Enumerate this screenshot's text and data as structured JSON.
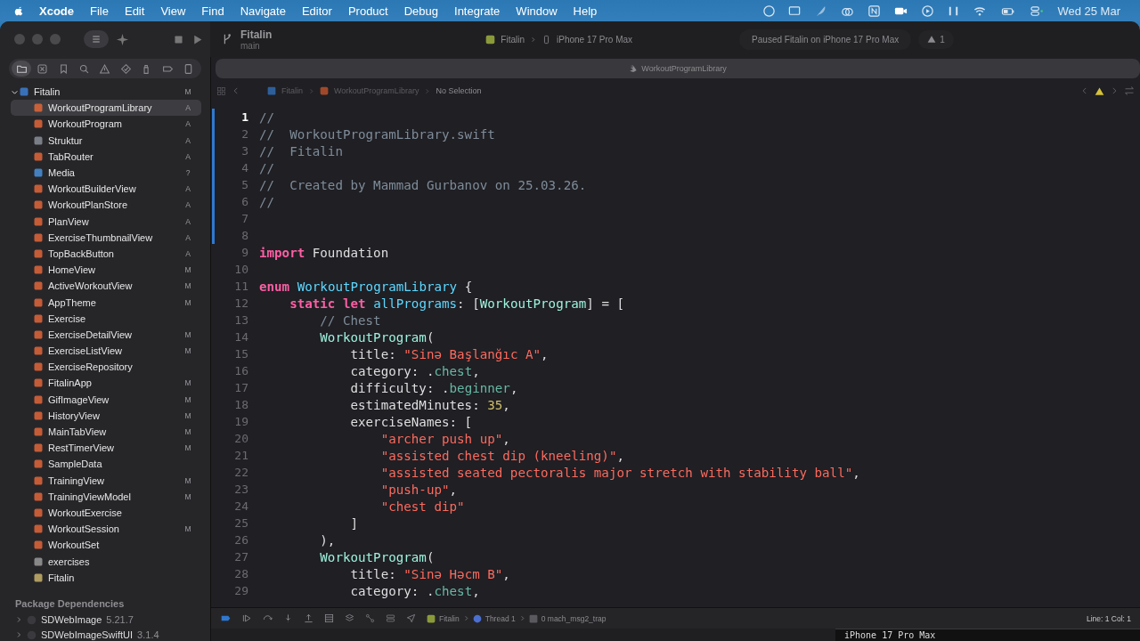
{
  "menu_bar": {
    "app": "Xcode",
    "items": [
      "File",
      "Edit",
      "View",
      "Find",
      "Navigate",
      "Editor",
      "Product",
      "Debug",
      "Integrate",
      "Window",
      "Help"
    ],
    "clock": "Wed 25 Mar"
  },
  "toolbar": {
    "project": "Fitalin",
    "branch": "main",
    "scheme": "Fitalin",
    "device": "iPhone 17 Pro Max",
    "status": "Paused Fitalin on iPhone 17 Pro Max",
    "warnings": "1"
  },
  "navigator": {
    "tabs": [
      {
        "kind": "folder",
        "selected": true
      },
      {
        "kind": "xbox",
        "selected": false
      },
      {
        "kind": "bookmark",
        "selected": false
      },
      {
        "kind": "search",
        "selected": false
      },
      {
        "kind": "warning",
        "selected": false
      },
      {
        "kind": "diamond",
        "selected": false
      },
      {
        "kind": "spray",
        "selected": false
      },
      {
        "kind": "tag",
        "selected": false
      },
      {
        "kind": "report",
        "selected": false
      }
    ],
    "tree": [
      {
        "name": "Fitalin",
        "badge": "M",
        "kind": "project",
        "expanded": true,
        "selected": false,
        "children": [
          {
            "name": "WorkoutProgramLibrary",
            "badge": "A",
            "kind": "swift",
            "selected": true
          },
          {
            "name": "WorkoutProgram",
            "badge": "A",
            "kind": "swift",
            "selected": false
          },
          {
            "name": "Struktur",
            "badge": "A",
            "kind": "doc",
            "selected": false
          },
          {
            "name": "TabRouter",
            "badge": "A",
            "kind": "swift",
            "selected": false
          },
          {
            "name": "Media",
            "badge": "?",
            "kind": "assets",
            "selected": false
          },
          {
            "name": "WorkoutBuilderView",
            "badge": "A",
            "kind": "swift",
            "selected": false
          },
          {
            "name": "WorkoutPlanStore",
            "badge": "A",
            "kind": "swift",
            "selected": false
          },
          {
            "name": "PlanView",
            "badge": "A",
            "kind": "swift",
            "selected": false
          },
          {
            "name": "ExerciseThumbnailView",
            "badge": "A",
            "kind": "swift",
            "selected": false
          },
          {
            "name": "TopBackButton",
            "badge": "A",
            "kind": "swift",
            "selected": false
          },
          {
            "name": "HomeView",
            "badge": "M",
            "kind": "swift",
            "selected": false
          },
          {
            "name": "ActiveWorkoutView",
            "badge": "M",
            "kind": "swift",
            "selected": false
          },
          {
            "name": "AppTheme",
            "badge": "M",
            "kind": "swift",
            "selected": false
          },
          {
            "name": "Exercise",
            "kind": "swift",
            "selected": false
          },
          {
            "name": "ExerciseDetailView",
            "badge": "M",
            "kind": "swift",
            "selected": false
          },
          {
            "name": "ExerciseListView",
            "badge": "M",
            "kind": "swift",
            "selected": false
          },
          {
            "name": "ExerciseRepository",
            "kind": "swift",
            "selected": false
          },
          {
            "name": "FitalinApp",
            "badge": "M",
            "kind": "swift",
            "selected": false
          },
          {
            "name": "GifImageView",
            "badge": "M",
            "kind": "swift",
            "selected": false
          },
          {
            "name": "HistoryView",
            "badge": "M",
            "kind": "swift",
            "selected": false
          },
          {
            "name": "MainTabView",
            "badge": "M",
            "kind": "swift",
            "selected": false
          },
          {
            "name": "RestTimerView",
            "badge": "M",
            "kind": "swift",
            "selected": false
          },
          {
            "name": "SampleData",
            "kind": "swift",
            "selected": false
          },
          {
            "name": "TrainingView",
            "badge": "M",
            "kind": "swift",
            "selected": false
          },
          {
            "name": "TrainingViewModel",
            "badge": "M",
            "kind": "swift",
            "selected": false
          },
          {
            "name": "WorkoutExercise",
            "kind": "swift",
            "selected": false
          },
          {
            "name": "WorkoutSession",
            "badge": "M",
            "kind": "swift",
            "selected": false
          },
          {
            "name": "WorkoutSet",
            "kind": "swift",
            "selected": false
          },
          {
            "name": "exercises",
            "kind": "json",
            "selected": false
          },
          {
            "name": "Fitalin",
            "kind": "entitlements",
            "selected": false
          }
        ]
      }
    ],
    "packages_title": "Package Dependencies",
    "packages": [
      {
        "name": "SDWebImage",
        "version": "5.21.7",
        "expanded": false
      },
      {
        "name": "SDWebImageSwiftUI",
        "version": "3.1.4",
        "expanded": false
      }
    ]
  },
  "editor": {
    "tab": "WorkoutProgramLibrary",
    "jump_bar": [
      "Fitalin",
      "WorkoutProgramLibrary",
      "No Selection"
    ],
    "lines": [
      {
        "n": "1",
        "current": true,
        "segments": [
          {
            "kind": "comment",
            "text": "//"
          }
        ]
      },
      {
        "n": "2",
        "current": false,
        "segments": [
          {
            "kind": "comment",
            "text": "//  WorkoutProgramLibrary.swift"
          }
        ]
      },
      {
        "n": "3",
        "current": false,
        "segments": [
          {
            "kind": "comment",
            "text": "//  Fitalin"
          }
        ]
      },
      {
        "n": "4",
        "current": false,
        "segments": [
          {
            "kind": "comment",
            "text": "//"
          }
        ]
      },
      {
        "n": "5",
        "current": false,
        "segments": [
          {
            "kind": "comment",
            "text": "//  Created by Mammad Gurbanov on 25.03.26."
          }
        ]
      },
      {
        "n": "6",
        "current": false,
        "segments": [
          {
            "kind": "comment",
            "text": "//"
          }
        ]
      },
      {
        "n": "7",
        "current": false
      },
      {
        "n": "8",
        "current": false
      },
      {
        "n": "9",
        "current": false,
        "segments": [
          {
            "kind": "keyword",
            "text": "import"
          },
          {
            "kind": "plain",
            "text": " Foundation"
          }
        ]
      },
      {
        "n": "10",
        "current": false
      },
      {
        "n": "11",
        "current": false,
        "segments": [
          {
            "kind": "keyword",
            "text": "enum"
          },
          {
            "kind": "decl",
            "text": " WorkoutProgramLibrary"
          },
          {
            "kind": "plain",
            "text": " {"
          }
        ]
      },
      {
        "n": "12",
        "current": false,
        "segments": [
          {
            "kind": "keyword",
            "text": "    static let"
          },
          {
            "kind": "decl",
            "text": " allPrograms"
          },
          {
            "kind": "plain",
            "text": ": ["
          },
          {
            "kind": "type",
            "text": "WorkoutProgram"
          },
          {
            "kind": "plain",
            "text": "] = ["
          }
        ]
      },
      {
        "n": "13",
        "current": false,
        "segments": [
          {
            "kind": "comment",
            "text": "        // Chest"
          }
        ]
      },
      {
        "n": "14",
        "current": false,
        "segments": [
          {
            "kind": "type",
            "text": "        WorkoutProgram"
          },
          {
            "kind": "plain",
            "text": "("
          }
        ]
      },
      {
        "n": "15",
        "current": false,
        "segments": [
          {
            "kind": "plain",
            "text": "            title: "
          },
          {
            "kind": "string",
            "text": "\"Sinə Başlanğıc A\""
          },
          {
            "kind": "plain",
            "text": ","
          }
        ]
      },
      {
        "n": "16",
        "current": false,
        "segments": [
          {
            "kind": "plain",
            "text": "            category: ."
          },
          {
            "kind": "member",
            "text": "chest"
          },
          {
            "kind": "plain",
            "text": ","
          }
        ]
      },
      {
        "n": "17",
        "current": false,
        "segments": [
          {
            "kind": "plain",
            "text": "            difficulty: ."
          },
          {
            "kind": "member",
            "text": "beginner"
          },
          {
            "kind": "plain",
            "text": ","
          }
        ]
      },
      {
        "n": "18",
        "current": false,
        "segments": [
          {
            "kind": "plain",
            "text": "            estimatedMinutes: "
          },
          {
            "kind": "number",
            "text": "35"
          },
          {
            "kind": "plain",
            "text": ","
          }
        ]
      },
      {
        "n": "19",
        "current": false,
        "segments": [
          {
            "kind": "plain",
            "text": "            exerciseNames: ["
          }
        ]
      },
      {
        "n": "20",
        "current": false,
        "segments": [
          {
            "kind": "string",
            "text": "                \"archer push up\""
          },
          {
            "kind": "plain",
            "text": ","
          }
        ]
      },
      {
        "n": "21",
        "current": false,
        "segments": [
          {
            "kind": "string",
            "text": "                \"assisted chest dip (kneeling)\""
          },
          {
            "kind": "plain",
            "text": ","
          }
        ]
      },
      {
        "n": "22",
        "current": false,
        "segments": [
          {
            "kind": "string",
            "text": "                \"assisted seated pectoralis major stretch with stability ball\""
          },
          {
            "kind": "plain",
            "text": ","
          }
        ]
      },
      {
        "n": "23",
        "current": false,
        "segments": [
          {
            "kind": "string",
            "text": "                \"push-up\""
          },
          {
            "kind": "plain",
            "text": ","
          }
        ]
      },
      {
        "n": "24",
        "current": false,
        "segments": [
          {
            "kind": "string",
            "text": "                \"chest dip\""
          }
        ]
      },
      {
        "n": "25",
        "current": false,
        "segments": [
          {
            "kind": "plain",
            "text": "            ]"
          }
        ]
      },
      {
        "n": "26",
        "current": false,
        "segments": [
          {
            "kind": "plain",
            "text": "        ),"
          }
        ]
      },
      {
        "n": "27",
        "current": false,
        "segments": [
          {
            "kind": "type",
            "text": "        WorkoutProgram"
          },
          {
            "kind": "plain",
            "text": "("
          }
        ]
      },
      {
        "n": "28",
        "current": false,
        "segments": [
          {
            "kind": "plain",
            "text": "            title: "
          },
          {
            "kind": "string",
            "text": "\"Sinə Həcm B\""
          },
          {
            "kind": "plain",
            "text": ","
          }
        ]
      },
      {
        "n": "29",
        "current": false,
        "segments": [
          {
            "kind": "plain",
            "text": "            category: ."
          },
          {
            "kind": "member",
            "text": "chest"
          },
          {
            "kind": "plain",
            "text": ","
          }
        ]
      }
    ]
  },
  "debug_bar": {
    "target": "Fitalin",
    "thread": "Thread 1",
    "frame": "0 mach_msg2_trap",
    "position": "Line: 1  Col: 1"
  },
  "device_window": {
    "title": "iPhone 17 Pro Max"
  }
}
